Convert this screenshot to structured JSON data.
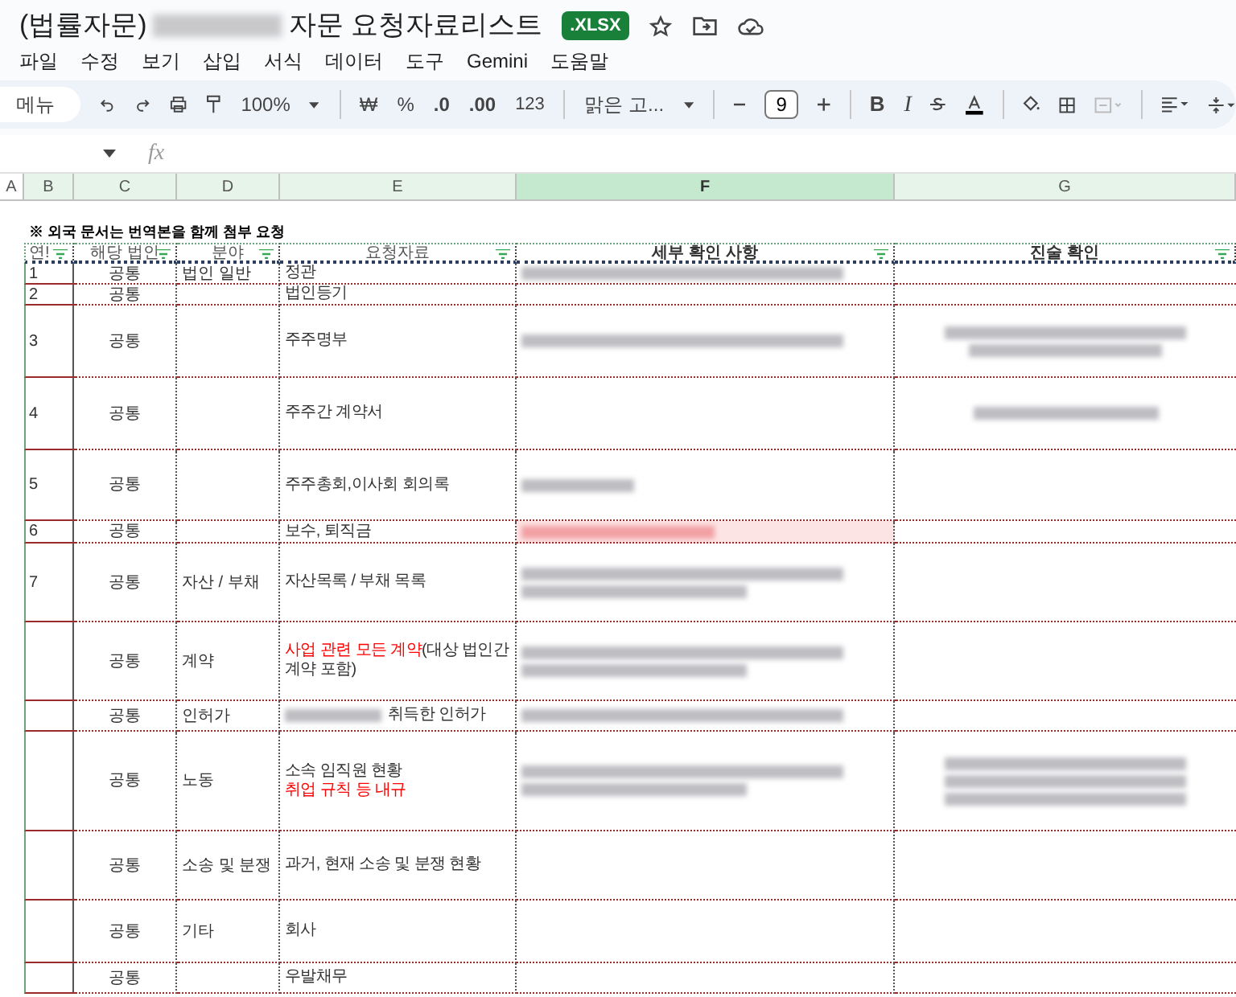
{
  "document": {
    "title_start": "(법률자문)",
    "title_end": "자문 요청자료리스트",
    "badge": ".XLSX"
  },
  "menu": [
    "파일",
    "수정",
    "보기",
    "삽입",
    "서식",
    "데이터",
    "도구",
    "Gemini",
    "도움말"
  ],
  "toolbar": {
    "search": "메뉴",
    "zoom": "100%",
    "currency": "₩",
    "percent": "%",
    "decrease_decimal": ".0",
    "increase_decimal": ".00",
    "number_format": "123",
    "font": "맑은 고...",
    "font_size": "9",
    "bold": "B",
    "italic": "I",
    "merge_disabled": true
  },
  "formula_bar": {
    "fx": "fx"
  },
  "columns": [
    {
      "letter": "A",
      "selected": false,
      "active": false
    },
    {
      "letter": "B",
      "selected": true,
      "active": false
    },
    {
      "letter": "C",
      "selected": true,
      "active": false
    },
    {
      "letter": "D",
      "selected": true,
      "active": false
    },
    {
      "letter": "E",
      "selected": true,
      "active": false
    },
    {
      "letter": "F",
      "selected": true,
      "active": true
    },
    {
      "letter": "G",
      "selected": true,
      "active": false
    }
  ],
  "note": "※ 외국 문서는 번역본을 함께 첨부 요청",
  "table": {
    "headers": [
      "연!",
      "해당 법인",
      "분야",
      "요청자료",
      "세부 확인 사항",
      "진술 확인"
    ],
    "rows": [
      {
        "no": "1",
        "entity": "공통",
        "area": "법인 일반",
        "item": [
          [
            {
              "text": "정관",
              "red": false
            }
          ]
        ],
        "details_blurred": true,
        "details_red": false,
        "statement_blurred": false
      },
      {
        "no": "2",
        "entity": "공통",
        "area": "",
        "item": [
          [
            {
              "text": "법인등기",
              "red": false
            }
          ]
        ],
        "details_blurred": false,
        "details_red": false,
        "statement_blurred": false
      },
      {
        "no": "3",
        "entity": "공통",
        "area": "",
        "item": [
          [
            {
              "text": "주주명부",
              "red": false
            }
          ]
        ],
        "details_blurred": true,
        "details_red": false,
        "statement_blurred": true
      },
      {
        "no": "4",
        "entity": "공통",
        "area": "",
        "item": [
          [
            {
              "text": "주주간 계약서",
              "red": false
            }
          ]
        ],
        "details_blurred": false,
        "details_red": false,
        "statement_blurred": true
      },
      {
        "no": "5",
        "entity": "공통",
        "area": "",
        "item": [
          [
            {
              "text": "주주총회,이사회 회의록",
              "red": false
            }
          ]
        ],
        "details_blurred": true,
        "details_red": false,
        "statement_blurred": false
      },
      {
        "no": "6",
        "entity": "공통",
        "area": "",
        "item": [
          [
            {
              "text": "보수, 퇴직금",
              "red": false
            }
          ]
        ],
        "details_blurred": true,
        "details_red": true,
        "statement_blurred": false
      },
      {
        "no": "7",
        "entity": "공통",
        "area": "자산 / 부채",
        "item": [
          [
            {
              "text": "자산목록 / 부채 목록",
              "red": false
            }
          ]
        ],
        "details_blurred": true,
        "details_red": false,
        "statement_blurred": false
      },
      {
        "no": "",
        "entity": "공통",
        "area": "계약",
        "item": [
          [
            {
              "text": "사업 관련 모든 계약",
              "red": true
            },
            {
              "text": "(대상 법인간",
              "red": false
            }
          ],
          [
            {
              "text": "계약 포함)",
              "red": false
            }
          ]
        ],
        "details_blurred": true,
        "details_red": false,
        "statement_blurred": false
      },
      {
        "no": "",
        "entity": "공통",
        "area": "인허가",
        "item": [
          [
            {
              "blurred": true
            },
            {
              "text": "취득한 인허가",
              "red": false
            }
          ]
        ],
        "details_blurred": true,
        "details_red": false,
        "statement_blurred": false
      },
      {
        "no": "",
        "entity": "공통",
        "area": "노동",
        "item": [
          [
            {
              "text": "소속 임직원 현황",
              "red": false
            }
          ],
          [
            {
              "text": "취업 규칙 등 내규",
              "red": true
            }
          ]
        ],
        "details_blurred": true,
        "details_red": false,
        "statement_blurred": true
      },
      {
        "no": "",
        "entity": "공통",
        "area": "소송 및 분쟁",
        "item": [
          [
            {
              "text": "과거, 현재 소송 및 분쟁 현황",
              "red": false
            }
          ]
        ],
        "details_blurred": false,
        "details_red": false,
        "statement_blurred": false
      },
      {
        "no": "",
        "entity": "공통",
        "area": "기타",
        "item": [
          [
            {
              "text": "회사",
              "red": false
            }
          ]
        ],
        "details_blurred": false,
        "details_red": false,
        "statement_blurred": false
      },
      {
        "no": "",
        "entity": "공통",
        "area": "",
        "item": [
          [
            {
              "text": "우발채무",
              "red": false
            }
          ]
        ],
        "details_blurred": false,
        "details_red": false,
        "statement_blurred": false
      }
    ]
  }
}
